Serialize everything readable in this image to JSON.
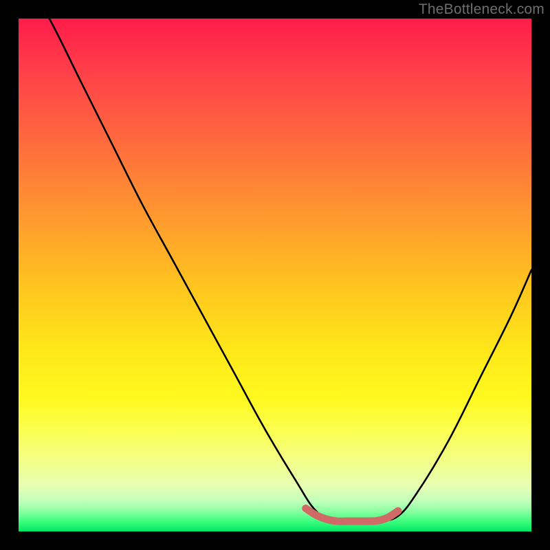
{
  "watermark": "TheBottleneck.com",
  "chart_data": {
    "type": "line",
    "title": "",
    "xlabel": "",
    "ylabel": "",
    "xlim": [
      0,
      100
    ],
    "ylim": [
      0,
      100
    ],
    "grid": false,
    "legend": false,
    "series": [
      {
        "name": "bottleneck-curve",
        "color": "#000000",
        "x": [
          0,
          6,
          12,
          18,
          24,
          30,
          36,
          42,
          48,
          54,
          58,
          62,
          66,
          70,
          74,
          78,
          84,
          90,
          96,
          100
        ],
        "values": [
          110,
          100,
          88,
          76,
          64,
          53,
          42,
          31,
          20,
          10,
          4,
          2,
          2,
          2,
          3,
          8,
          18,
          30,
          42,
          51
        ]
      },
      {
        "name": "optimal-band",
        "color": "#cf6a66",
        "x": [
          56,
          58,
          60,
          62,
          64,
          66,
          68,
          70,
          72,
          74
        ],
        "values": [
          4.5,
          3.2,
          2.4,
          2.0,
          2.0,
          2.0,
          2.0,
          2.1,
          2.7,
          4.0
        ]
      }
    ],
    "background_gradient": {
      "top": "#ff1c4a",
      "mid": "#ffe619",
      "bottom": "#00e765"
    }
  }
}
